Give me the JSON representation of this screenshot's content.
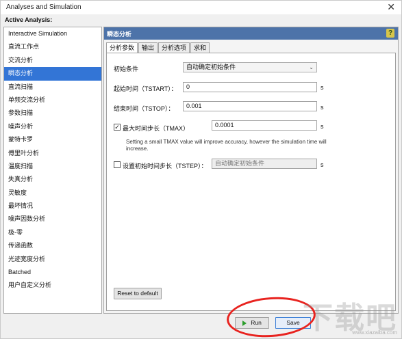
{
  "window": {
    "title": "Analyses and Simulation",
    "close_glyph": "✕"
  },
  "active_analysis_label": "Active Analysis:",
  "analysis_list": [
    {
      "label": "Interactive Simulation"
    },
    {
      "label": "直流工作点"
    },
    {
      "label": "交流分析"
    },
    {
      "label": "瞬态分析",
      "selected": true
    },
    {
      "label": "直流扫描"
    },
    {
      "label": "单频交流分析"
    },
    {
      "label": "参数扫描"
    },
    {
      "label": "噪声分析"
    },
    {
      "label": "蒙特卡罗"
    },
    {
      "label": "傅里叶分析"
    },
    {
      "label": "温度扫描"
    },
    {
      "label": "失真分析"
    },
    {
      "label": "灵敏度"
    },
    {
      "label": "最坏情况"
    },
    {
      "label": "噪声因数分析"
    },
    {
      "label": "极-零"
    },
    {
      "label": "传递函数"
    },
    {
      "label": "光迹宽度分析"
    },
    {
      "label": "Batched"
    },
    {
      "label": "用户自定义分析"
    }
  ],
  "panel": {
    "title": "瞬态分析",
    "help_icon_glyph": "?",
    "tabs": [
      "分析参数",
      "输出",
      "分析选项",
      "求和"
    ],
    "initial_condition": {
      "label": "初始条件",
      "value": "自动确定初始条件",
      "arrow": "⌄"
    },
    "tstart": {
      "label": "起始时间（TSTART）：",
      "value": "0",
      "unit": "s"
    },
    "tstop": {
      "label": "结束时间（TSTOP）：",
      "value": "0.001",
      "unit": "s"
    },
    "tmax": {
      "checkbox_mark": "✓",
      "label": "最大时间步长（TMAX）",
      "value": "0.0001",
      "unit": "s",
      "checked": true
    },
    "note": "Setting a small TMAX value will improve accuracy, however the simulation time will increase.",
    "tstep": {
      "label": "设置初始时间步长（TSTEP）：",
      "value": "自动确定初始条件",
      "unit": "s",
      "checked": false
    },
    "reset_button": "Reset to default"
  },
  "footer": {
    "run_button": "Run",
    "save_button": "Save"
  },
  "watermark": {
    "text": "下载吧",
    "sub": "www.xiazaiba.com"
  },
  "colors": {
    "header": "#4d73a9",
    "selection": "#3375d6",
    "annotation_circle": "#e8231f"
  }
}
